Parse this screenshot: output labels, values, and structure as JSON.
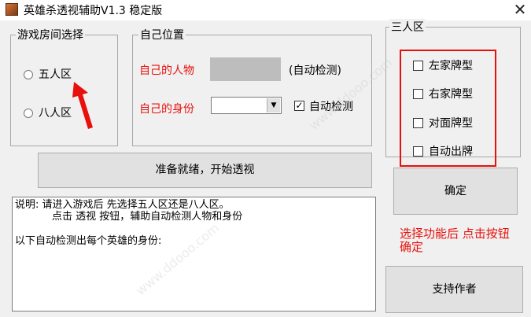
{
  "window": {
    "title": "英雄杀透视辅助V1.3 稳定版",
    "close_glyph": "✕"
  },
  "room_group": {
    "legend": "游戏房间选择",
    "options": [
      {
        "label": "五人区",
        "selected": false
      },
      {
        "label": "八人区",
        "selected": false
      }
    ]
  },
  "position_group": {
    "legend": "自己位置",
    "character_label": "自己的人物",
    "auto_detect_label": "(自动检测)",
    "identity_label": "自己的身份",
    "identity_value": "",
    "auto_detect_checkbox": {
      "label": "自动检测",
      "checked": true
    }
  },
  "start_button": "准备就绪，开始透视",
  "description": {
    "line1": "说明: 请进入游戏后 先选择五人区还是八人区。",
    "line2": "点击 透视 按钮，辅助自动检测人物和身份",
    "line3": "以下自动检测出每个英雄的身份:"
  },
  "three_group": {
    "legend": "三人区",
    "options": [
      {
        "label": "左家牌型",
        "checked": false
      },
      {
        "label": "右家牌型",
        "checked": false
      },
      {
        "label": "对面牌型",
        "checked": false
      },
      {
        "label": "自动出牌",
        "checked": false
      }
    ]
  },
  "confirm_button": "确定",
  "hint_text": "选择功能后 点击按钮确定",
  "support_button": "支持作者",
  "colors": {
    "highlight_red": "#e8100c",
    "window_bg": "#f0f0f0"
  },
  "watermark": "www.ddooo.com"
}
